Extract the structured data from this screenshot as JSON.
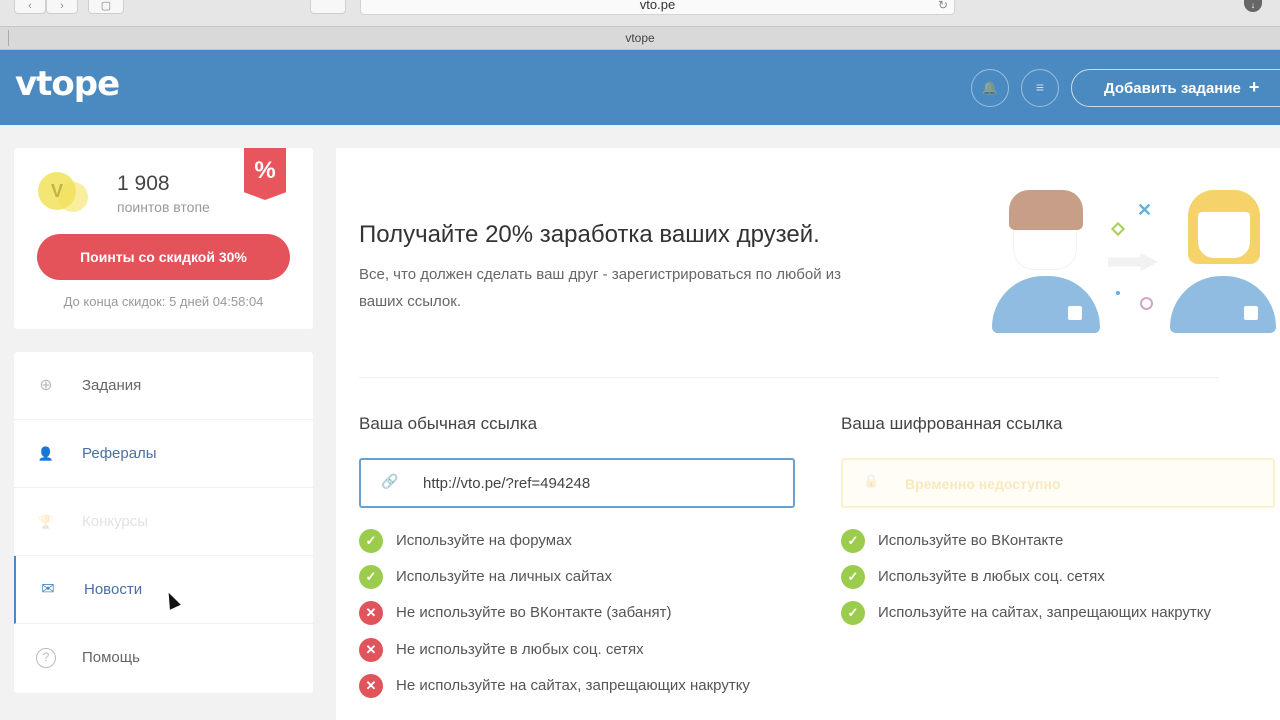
{
  "browser": {
    "url": "vto.pe",
    "tab_title": "vtope",
    "back_icon": "chevron-left",
    "forward_icon": "chevron-right",
    "sidebar_icon": "sidebar",
    "reload_icon": "reload",
    "download_icon": "download",
    "back_glyph": "‹",
    "forward_glyph": "›",
    "sidebar_glyph": "▢",
    "reload_glyph": "↻",
    "download_glyph": "↓"
  },
  "header": {
    "logo": "vtope",
    "bell_glyph": "🔔",
    "menu_glyph": "≡",
    "add_task_label": "Добавить задание",
    "add_task_plus": "+",
    "accent_color": "#4a8ac0"
  },
  "points": {
    "coin_glyph": "V",
    "value": "1 908",
    "label": "поинтов втопе",
    "badge": "%",
    "discount_button": "Поинты со скидкой 30%",
    "discount_ends": "До конца скидок: 5 дней 04:58:04",
    "button_color": "#e4525a"
  },
  "menu": {
    "items": [
      {
        "label": "Задания",
        "icon": "task-icon",
        "glyph": "⊕"
      },
      {
        "label": "Рефералы",
        "icon": "user-icon",
        "glyph": "👤"
      },
      {
        "label": "Конкурсы",
        "icon": "trophy-icon",
        "glyph": "🏆"
      },
      {
        "label": "Новости",
        "icon": "mail-icon",
        "glyph": "✉"
      },
      {
        "label": "Помощь",
        "icon": "help-icon",
        "glyph": "?"
      }
    ],
    "active": "Новости"
  },
  "main": {
    "headline": "Получайте 20% заработка ваших друзей.",
    "description": "Все, что должен сделать ваш друг - зарегистрироваться по любой из ваших ссылок.",
    "regular_link_title": "Ваша обычная ссылка",
    "regular_link": "http://vto.pe/?ref=494248",
    "cipher_link_title": "Ваша шифрованная ссылка",
    "cipher_link_text": "Временно недоступно",
    "chain_glyph": "🔗",
    "lock_glyph": "🔒",
    "ok_glyph": "✓",
    "no_glyph": "✕",
    "regular_rules": [
      {
        "text": "Используйте на форумах",
        "ok": true
      },
      {
        "text": "Используйте на личных сайтах",
        "ok": true
      },
      {
        "text": "Не используйте во ВКонтакте (забанят)",
        "ok": false
      },
      {
        "text": "Не используйте в любых соц. сетях",
        "ok": false
      },
      {
        "text": "Не используйте на сайтах, запрещающих накрутку",
        "ok": false
      }
    ],
    "cipher_rules": [
      {
        "text": "Используйте во ВКонтакте",
        "ok": true
      },
      {
        "text": "Используйте в любых соц. сетях",
        "ok": true
      },
      {
        "text": "Используйте на сайтах, запрещающих накрутку",
        "ok": true
      }
    ],
    "illustration_x": "✕"
  }
}
